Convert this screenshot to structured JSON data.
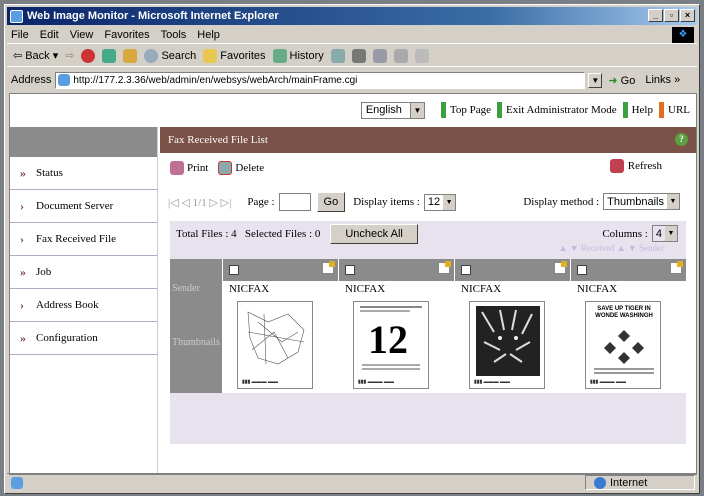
{
  "window": {
    "title": "Web Image Monitor - Microsoft Internet Explorer"
  },
  "menu": [
    "File",
    "Edit",
    "View",
    "Favorites",
    "Tools",
    "Help"
  ],
  "toolbar": {
    "back": "Back",
    "search": "Search",
    "favorites": "Favorites",
    "history": "History"
  },
  "address": {
    "label": "Address",
    "url": "http://177.2.3.36/web/admin/en/websys/webArch/mainFrame.cgi",
    "go": "Go",
    "links": "Links »"
  },
  "topnav": {
    "language": "English",
    "links": [
      {
        "label": "Top Page",
        "color": "#3aa040"
      },
      {
        "label": "Exit Administrator Mode",
        "color": "#3aa040"
      },
      {
        "label": "Help",
        "color": "#3aa040"
      },
      {
        "label": "URL",
        "color": "#e07020"
      }
    ]
  },
  "sidebar": [
    "Status",
    "Document Server",
    "Fax Received File",
    "Job",
    "Address Book",
    "Configuration"
  ],
  "main": {
    "title": "Fax Received File List",
    "print": "Print",
    "delete": "Delete",
    "refresh": "Refresh",
    "pager": {
      "page_of": "1/1",
      "page_label": "Page :",
      "go": "Go",
      "display_items_label": "Display items :",
      "display_items": "12",
      "display_method_label": "Display method :",
      "display_method": "Thumbnails"
    },
    "totals": {
      "text": "Total Files : 4   Selected Files : 0",
      "uncheck": "Uncheck All",
      "columns_label": "Columns :",
      "columns": "4",
      "sort": "▲ ▼ Received  ▲ ▼ Sender"
    },
    "row_labels": {
      "sender": "Sender",
      "thumbnails": "Thumbnails"
    },
    "files": [
      {
        "sender": "NICFAX"
      },
      {
        "sender": "NICFAX",
        "big_number": "12"
      },
      {
        "sender": "NICFAX"
      },
      {
        "sender": "NICFAX",
        "headline": "SAVE UP TIGER IN WONDE WASHINGH"
      }
    ]
  },
  "statusbar": {
    "zone": "Internet"
  }
}
